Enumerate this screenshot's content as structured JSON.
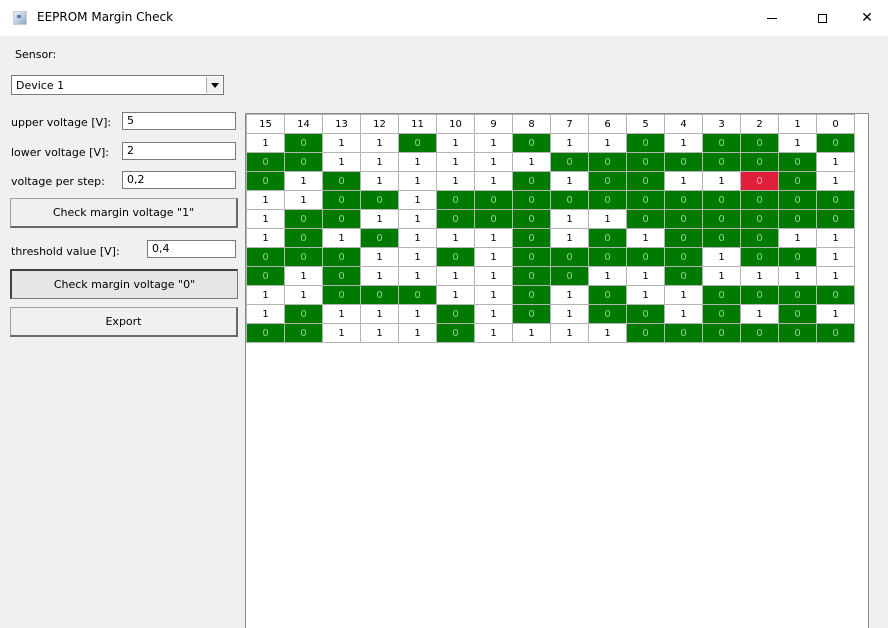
{
  "window": {
    "title": "EEPROM Margin Check",
    "icon": "app-window-icon"
  },
  "sensor": {
    "label": "Sensor:",
    "selected": "Device 1"
  },
  "fields": {
    "upper_label": "upper voltage [V]:",
    "upper_value": "5",
    "lower_label": "lower voltage [V]:",
    "lower_value": "2",
    "step_label": "voltage per step:",
    "step_value": "0,2",
    "threshold_label": "threshold value [V]:",
    "threshold_value": "0,4"
  },
  "buttons": {
    "check1": "Check margin voltage \"1\"",
    "check0": "Check margin voltage \"0\"",
    "export": "Export"
  },
  "colors": {
    "ok": "#007a00",
    "error": "#e0203a",
    "one": "#ffffff"
  },
  "grid": {
    "columns": [
      "15",
      "14",
      "13",
      "12",
      "11",
      "10",
      "9",
      "8",
      "7",
      "6",
      "5",
      "4",
      "3",
      "2",
      "1",
      "0"
    ],
    "rows": [
      [
        "1",
        "0",
        "1",
        "1",
        "0",
        "1",
        "1",
        "0",
        "1",
        "1",
        "0",
        "1",
        "0",
        "0",
        "1",
        "0"
      ],
      [
        "0",
        "0",
        "1",
        "1",
        "1",
        "1",
        "1",
        "1",
        "0",
        "0",
        "0",
        "0",
        "0",
        "0",
        "0",
        "1"
      ],
      [
        "0",
        "1",
        "0",
        "1",
        "1",
        "1",
        "1",
        "0",
        "1",
        "0",
        "0",
        "1",
        "1",
        "0!",
        "0",
        "1"
      ],
      [
        "1",
        "1",
        "0",
        "0",
        "1",
        "0",
        "0",
        "0",
        "0",
        "0",
        "0",
        "0",
        "0",
        "0",
        "0",
        "0"
      ],
      [
        "1",
        "0",
        "0",
        "1",
        "1",
        "0",
        "0",
        "0",
        "1",
        "1",
        "0",
        "0",
        "0",
        "0",
        "0",
        "0"
      ],
      [
        "1",
        "0",
        "1",
        "0",
        "1",
        "1",
        "1",
        "0",
        "1",
        "0",
        "1",
        "0",
        "0",
        "0",
        "1",
        "1"
      ],
      [
        "0",
        "0",
        "0",
        "1",
        "1",
        "0",
        "1",
        "0",
        "0",
        "0",
        "0",
        "0",
        "1",
        "0",
        "0",
        "1"
      ],
      [
        "0",
        "1",
        "0",
        "1",
        "1",
        "1",
        "1",
        "0",
        "0",
        "1",
        "1",
        "0",
        "1",
        "1",
        "1",
        "1"
      ],
      [
        "1",
        "1",
        "0",
        "0",
        "0",
        "1",
        "1",
        "0",
        "1",
        "0",
        "1",
        "1",
        "0",
        "0",
        "0",
        "0"
      ],
      [
        "1",
        "0",
        "1",
        "1",
        "1",
        "0",
        "1",
        "0",
        "1",
        "0",
        "0",
        "1",
        "0",
        "1",
        "0",
        "1"
      ],
      [
        "0",
        "0",
        "1",
        "1",
        "1",
        "0",
        "1",
        "1",
        "1",
        "1",
        "0",
        "0",
        "0",
        "0",
        "0",
        "0"
      ]
    ]
  }
}
